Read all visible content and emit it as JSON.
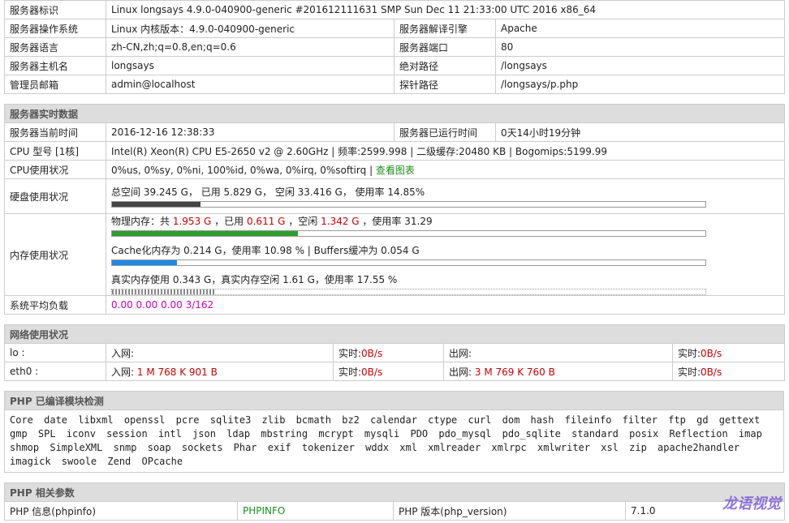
{
  "server_info": {
    "rows": [
      {
        "label": "服务器标识",
        "value": "Linux longsays 4.9.0-040900-generic #201612111631 SMP Sun Dec 11 21:33:00 UTC 2016 x86_64"
      },
      {
        "label": "服务器操作系统",
        "value": "Linux  内核版本：4.9.0-040900-generic",
        "label2": "服务器解译引擎",
        "value2": "Apache"
      },
      {
        "label": "服务器语言",
        "value": "zh-CN,zh;q=0.8,en;q=0.6",
        "label2": "服务器端口",
        "value2": "80"
      },
      {
        "label": "服务器主机名",
        "value": "longsays",
        "label2": "绝对路径",
        "value2": "/longsays"
      },
      {
        "label": "管理员邮箱",
        "value": "admin@localhost",
        "label2": "探针路径",
        "value2": "/longsays/p.php"
      }
    ]
  },
  "realtime": {
    "title": "服务器实时数据",
    "current_time_label": "服务器当前时间",
    "current_time": "2016-12-16 12:38:33",
    "uptime_label": "服务器已运行时间",
    "uptime": "0天14小时19分钟",
    "cpu_label": "CPU 型号 [1核]",
    "cpu_value": "Intel(R) Xeon(R) CPU E5-2650 v2 @ 2.60GHz | 频率:2599.998 | 二级缓存:20480 KB | Bogomips:5199.99",
    "cpu_usage_label": "CPU使用状况",
    "cpu_usage_value": "0%us, 0%sy, 0%ni, 100%id, 0%wa, 0%irq, 0%softirq",
    "cpu_chart_link": "查看图表",
    "disk_label": "硬盘使用状况",
    "disk_value": "总空间 39.245 G， 已用 5.829 G， 空闲 33.416 G， 使用率 14.85%",
    "disk_usage_pct": 14.85,
    "mem_label": "内存使用状况",
    "mem_phys_prefix": "物理内存：共",
    "mem_total": "1.953 G",
    "mem_used_prefix": "，已用",
    "mem_used": "0.611 G",
    "mem_free_prefix": "，空闲",
    "mem_free": "1.342 G",
    "mem_rate": "，使用率 31.29",
    "mem_usage_pct": 31.29,
    "cache_value": "Cache化内存为 0.214 G，使用率 10.98 % | Buffers缓冲为 0.054 G",
    "cache_usage_pct": 10.98,
    "real_mem_value": "真实内存使用 0.343 G，真实内存空闲 1.61 G，使用率 17.55 %",
    "real_mem_usage_pct": 17.55,
    "load_label": "系统平均负载",
    "load_value": "0.00 0.00 0.00 3/162"
  },
  "network": {
    "title": "网络使用状况",
    "rows": [
      {
        "iface": "lo :",
        "in_label": "入网:",
        "in_value": "",
        "rt_label": "实时:",
        "rt_in": "0B/s",
        "out_label": "出网:",
        "out_value": "",
        "rt_label2": "实时:",
        "rt_out": "0B/s"
      },
      {
        "iface": "eth0 :",
        "in_label": "入网:",
        "in_value": "1 M 768 K 901 B",
        "rt_label": "实时:",
        "rt_in": "0B/s",
        "out_label": "出网:",
        "out_value": "3 M 769 K 760 B",
        "rt_label2": "实时:",
        "rt_out": "0B/s"
      }
    ]
  },
  "modules": {
    "title": "PHP 已编译模块检测",
    "text": "Core  date  libxml  openssl  pcre  sqlite3  zlib  bcmath  bz2  calendar  ctype  curl  dom  hash  fileinfo  filter  ftp  gd  gettext  gmp  SPL  iconv  session  intl  json  ldap  mbstring  mcrypt  mysqli  PDO  pdo_mysql  pdo_sqlite  standard  posix  Reflection  imap  shmop  SimpleXML  snmp  soap  sockets  Phar  exif  tokenizer  wddx  xml  xmlreader  xmlrpc  xmlwriter  xsl  zip  apache2handler  imagick  swoole  Zend OPcache"
  },
  "php_params": {
    "title": "PHP 相关参数",
    "phpinfo_label": "PHP 信息(phpinfo)",
    "phpinfo_link": "PHPINFO",
    "version_label": "PHP 版本(php_version)",
    "version_value": "7.1.0"
  },
  "watermark": "龙语视觉"
}
